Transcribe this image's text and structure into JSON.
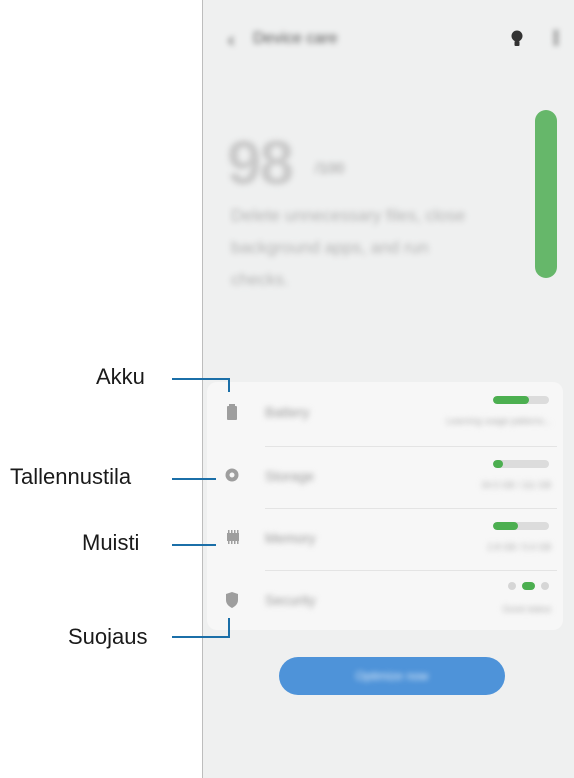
{
  "callouts": {
    "battery": "Akku",
    "storage": "Tallennustila",
    "memory": "Muisti",
    "security": "Suojaus"
  },
  "screen": {
    "title": "Device care",
    "score": "98",
    "score_unit": "/100",
    "description": "Delete unnecessary files, close background apps, and run checks.",
    "optimize_button": "Optimize now",
    "items": [
      {
        "label": "Battery",
        "sub": "Learning usage patterns...",
        "level": 0.65
      },
      {
        "label": "Storage",
        "sub": "34.5 GB / 111 GB",
        "level": 0.18
      },
      {
        "label": "Memory",
        "sub": "2.8 GB / 5.6 GB",
        "level": 0.45
      },
      {
        "label": "Security",
        "sub": "Good status"
      }
    ]
  },
  "colors": {
    "accent_green": "#4caf50",
    "button_blue": "#4e93d9",
    "callout_line": "#1b6fa8"
  }
}
